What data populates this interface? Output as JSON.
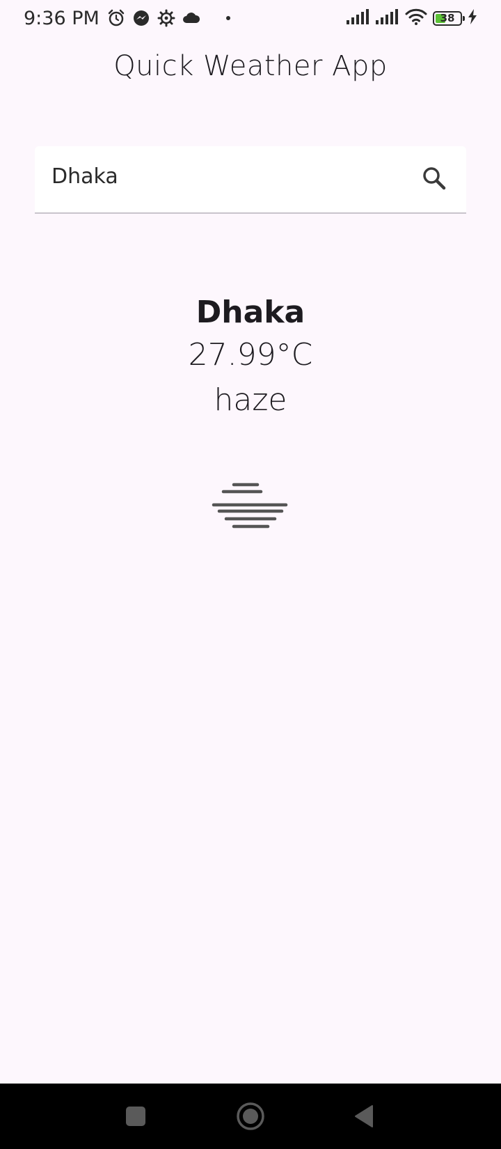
{
  "status_bar": {
    "time": "9:36 PM",
    "icons": [
      "alarm-icon",
      "messenger-icon",
      "settings-gear-icon",
      "cloud-icon",
      "dot-icon"
    ],
    "right_icons": [
      "signal-icon",
      "signal-icon",
      "wifi-icon",
      "battery-icon",
      "charging-bolt-icon"
    ],
    "battery_level": "38",
    "battery_color": "#5bc236"
  },
  "app": {
    "title": "Quick Weather App"
  },
  "search": {
    "value": "Dhaka",
    "icon": "search-icon"
  },
  "weather": {
    "city": "Dhaka",
    "temperature": "27.99°C",
    "description": "haze",
    "icon": "haze-icon"
  },
  "nav_bar": {
    "buttons": [
      "recent-apps-icon",
      "home-icon",
      "back-icon"
    ]
  },
  "colors": {
    "background": "#fdf7fd",
    "text": "#1d1b20",
    "nav_background": "#000000"
  }
}
